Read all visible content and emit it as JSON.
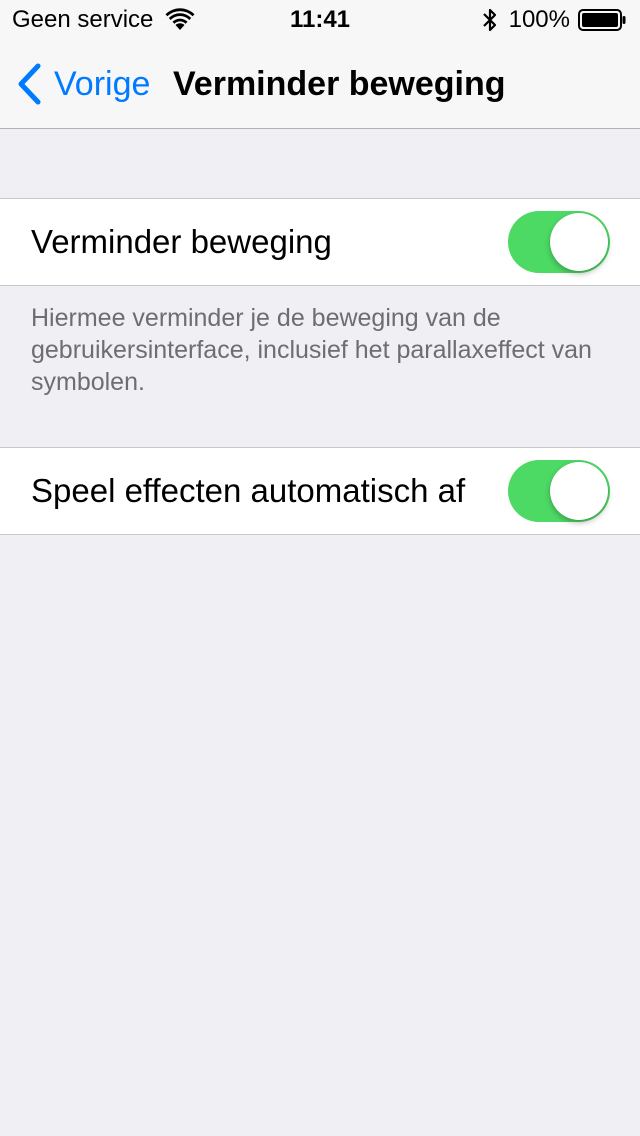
{
  "status_bar": {
    "carrier": "Geen service",
    "time": "11:41",
    "battery_percent": "100%",
    "icons": [
      "wifi-icon",
      "bluetooth-icon",
      "battery-icon"
    ]
  },
  "nav": {
    "back_label": "Vorige",
    "title": "Verminder beweging"
  },
  "settings": {
    "reduce_motion": {
      "label": "Verminder beweging",
      "enabled": true
    },
    "description": "Hiermee verminder je de beweging van de gebruikersinterface, inclusief het parallaxeffect van symbolen.",
    "auto_play_effects": {
      "label": "Speel effecten automatisch af",
      "enabled": true
    }
  },
  "colors": {
    "accent": "#007aff",
    "toggle_on": "#4cd964",
    "background": "#efeff4"
  }
}
